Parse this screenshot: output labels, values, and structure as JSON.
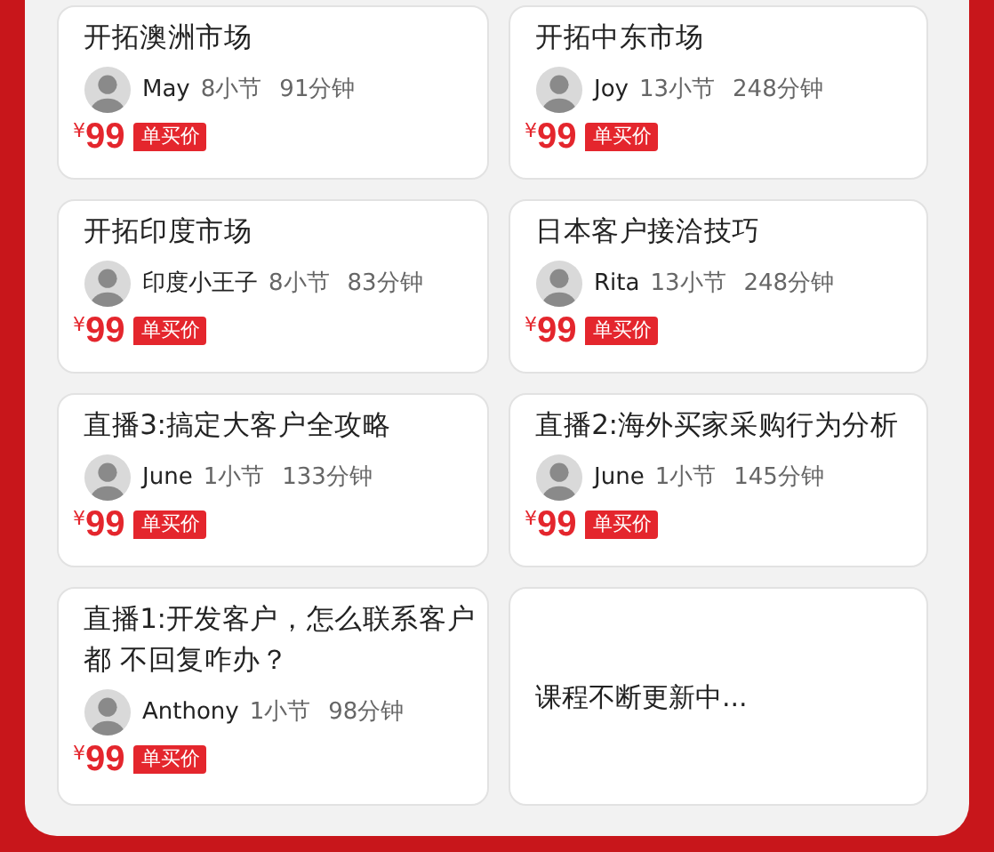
{
  "courses": [
    {
      "kind": "course",
      "title": "开拓澳洲市场",
      "teacher": "May",
      "lessons": "8小节",
      "duration": "91分钟",
      "currency": "¥",
      "price": "99",
      "badge": "单买价"
    },
    {
      "kind": "course",
      "title": "开拓中东市场",
      "teacher": "Joy",
      "lessons": "13小节",
      "duration": "248分钟",
      "currency": "¥",
      "price": "99",
      "badge": "单买价"
    },
    {
      "kind": "course",
      "title": "开拓印度市场",
      "teacher": "印度小王子",
      "lessons": "8小节",
      "duration": "83分钟",
      "currency": "¥",
      "price": "99",
      "badge": "单买价"
    },
    {
      "kind": "course",
      "title": "日本客户接洽技巧",
      "teacher": "Rita",
      "lessons": "13小节",
      "duration": "248分钟",
      "currency": "¥",
      "price": "99",
      "badge": "单买价"
    },
    {
      "kind": "course",
      "title": "直播3:搞定大客户全攻略",
      "teacher": "June",
      "lessons": "1小节",
      "duration": "133分钟",
      "currency": "¥",
      "price": "99",
      "badge": "单买价"
    },
    {
      "kind": "course",
      "title": "直播2:海外买家采购行为分析",
      "teacher": "June",
      "lessons": "1小节",
      "duration": "145分钟",
      "currency": "¥",
      "price": "99",
      "badge": "单买价"
    },
    {
      "kind": "course",
      "title": "直播1:开发客户，怎么联系客户都 不回复咋办？",
      "teacher": "Anthony",
      "lessons": "1小节",
      "duration": "98分钟",
      "currency": "¥",
      "price": "99",
      "badge": "单买价"
    },
    {
      "kind": "notice",
      "text": "课程不断更新中..."
    }
  ]
}
